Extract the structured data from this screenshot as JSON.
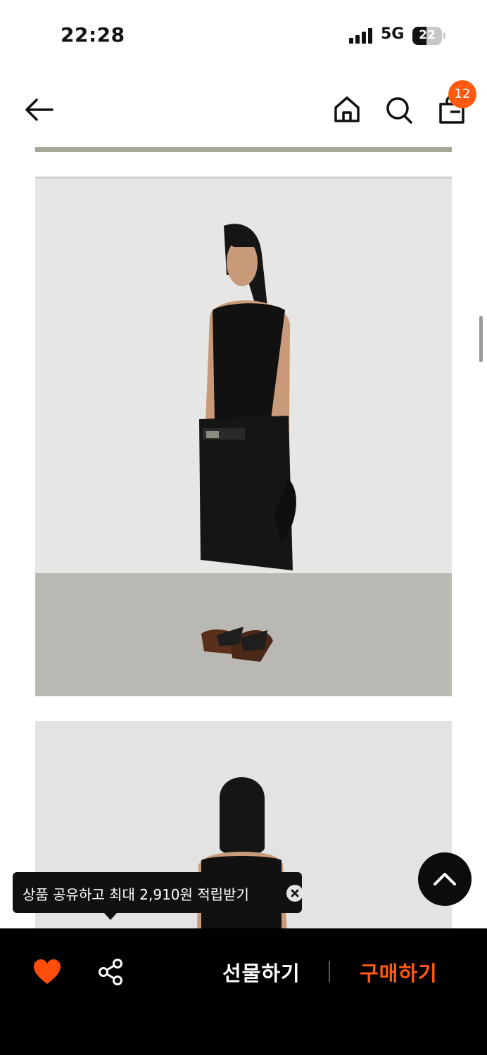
{
  "status_bar": {
    "time": "22:28",
    "network": "5G",
    "battery": "22"
  },
  "nav": {
    "cart_count": "12"
  },
  "tooltip": {
    "text": "상품 공유하고 최대 2,910원 적립받기"
  },
  "bottom_bar": {
    "gift_label": "선물하기",
    "buy_label": "구매하기"
  },
  "colors": {
    "accent": "#ff5a0f",
    "bar_bg": "#000000",
    "heart": "#ff4d0a"
  },
  "icons": [
    "back-arrow-icon",
    "home-icon",
    "search-icon",
    "shopping-bag-icon",
    "chevron-up-icon",
    "close-icon",
    "heart-icon",
    "share-icon"
  ]
}
